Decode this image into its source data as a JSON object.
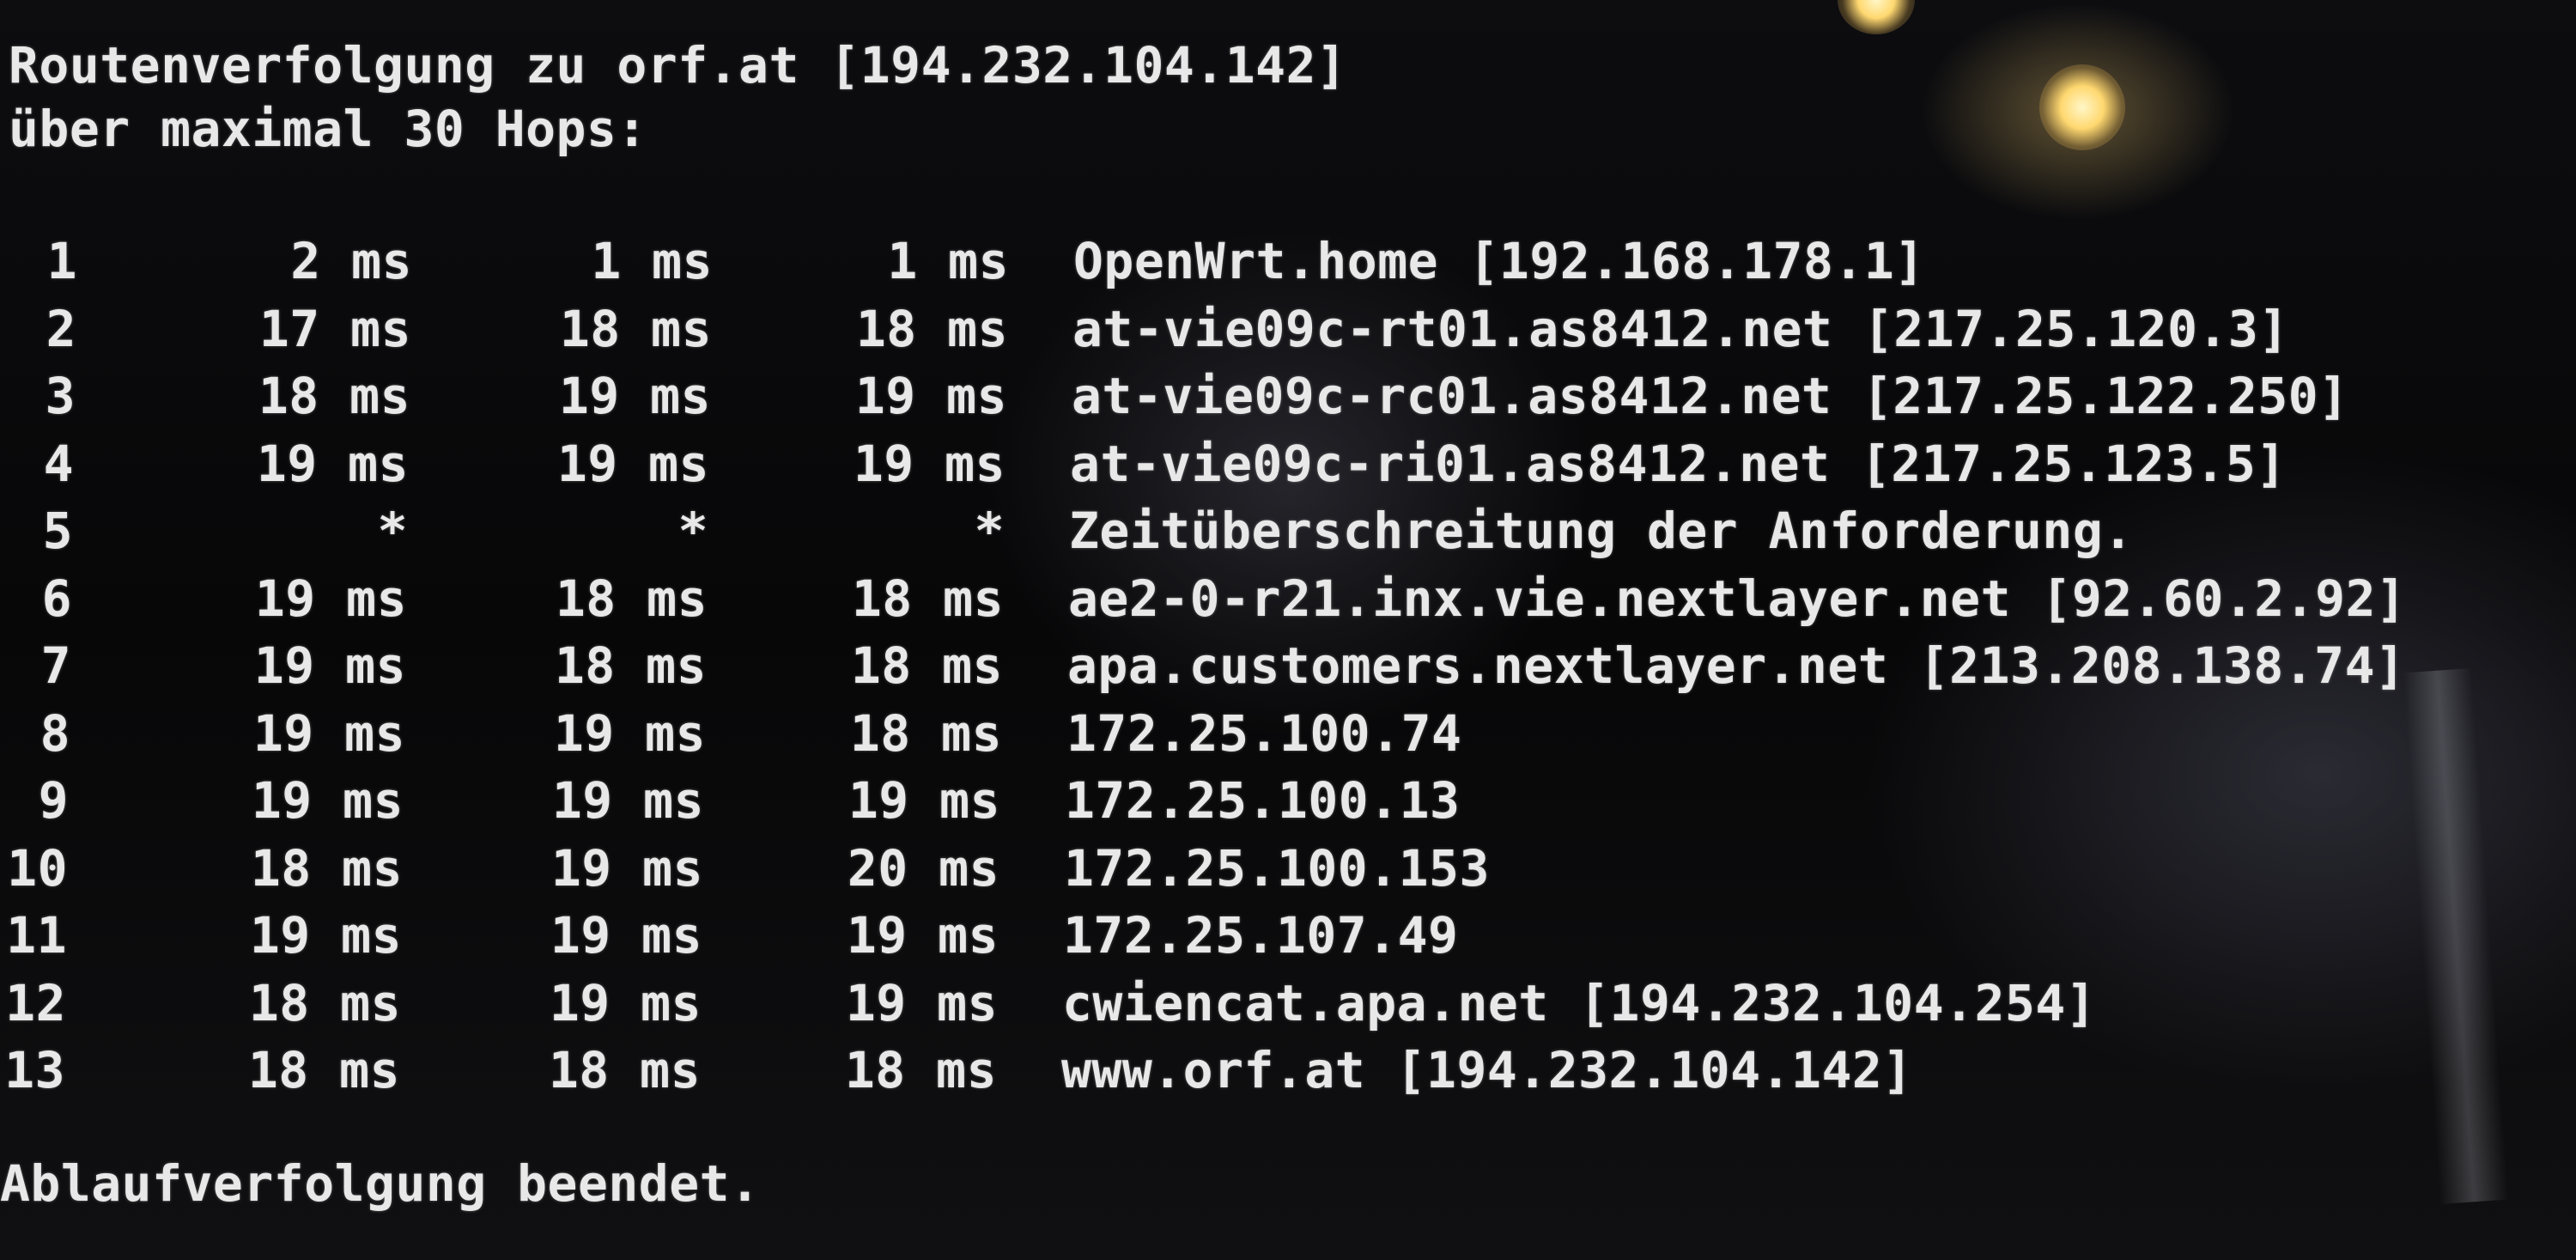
{
  "tracert": {
    "header_line_1": "Routenverfolgung zu orf.at [194.232.104.142]",
    "header_line_2": "über maximal 30 Hops:",
    "hops": [
      {
        "num": "1",
        "t1": "2 ms",
        "t2": "1 ms",
        "t3": "1 ms",
        "host": "OpenWrt.home [192.168.178.1]"
      },
      {
        "num": "2",
        "t1": "17 ms",
        "t2": "18 ms",
        "t3": "18 ms",
        "host": "at-vie09c-rt01.as8412.net [217.25.120.3]"
      },
      {
        "num": "3",
        "t1": "18 ms",
        "t2": "19 ms",
        "t3": "19 ms",
        "host": "at-vie09c-rc01.as8412.net [217.25.122.250]"
      },
      {
        "num": "4",
        "t1": "19 ms",
        "t2": "19 ms",
        "t3": "19 ms",
        "host": "at-vie09c-ri01.as8412.net [217.25.123.5]"
      },
      {
        "num": "5",
        "t1": "*",
        "t2": "*",
        "t3": "*",
        "host": "Zeitüberschreitung der Anforderung."
      },
      {
        "num": "6",
        "t1": "19 ms",
        "t2": "18 ms",
        "t3": "18 ms",
        "host": "ae2-0-r21.inx.vie.nextlayer.net [92.60.2.92]"
      },
      {
        "num": "7",
        "t1": "19 ms",
        "t2": "18 ms",
        "t3": "18 ms",
        "host": "apa.customers.nextlayer.net [213.208.138.74]"
      },
      {
        "num": "8",
        "t1": "19 ms",
        "t2": "19 ms",
        "t3": "18 ms",
        "host": "172.25.100.74"
      },
      {
        "num": "9",
        "t1": "19 ms",
        "t2": "19 ms",
        "t3": "19 ms",
        "host": "172.25.100.13"
      },
      {
        "num": "10",
        "t1": "18 ms",
        "t2": "19 ms",
        "t3": "20 ms",
        "host": "172.25.100.153"
      },
      {
        "num": "11",
        "t1": "19 ms",
        "t2": "19 ms",
        "t3": "19 ms",
        "host": "172.25.107.49"
      },
      {
        "num": "12",
        "t1": "18 ms",
        "t2": "19 ms",
        "t3": "19 ms",
        "host": "cwiencat.apa.net [194.232.104.254]"
      },
      {
        "num": "13",
        "t1": "18 ms",
        "t2": "18 ms",
        "t3": "18 ms",
        "host": "www.orf.at [194.232.104.142]"
      }
    ],
    "footer_line": "Ablaufverfolgung beendet."
  }
}
